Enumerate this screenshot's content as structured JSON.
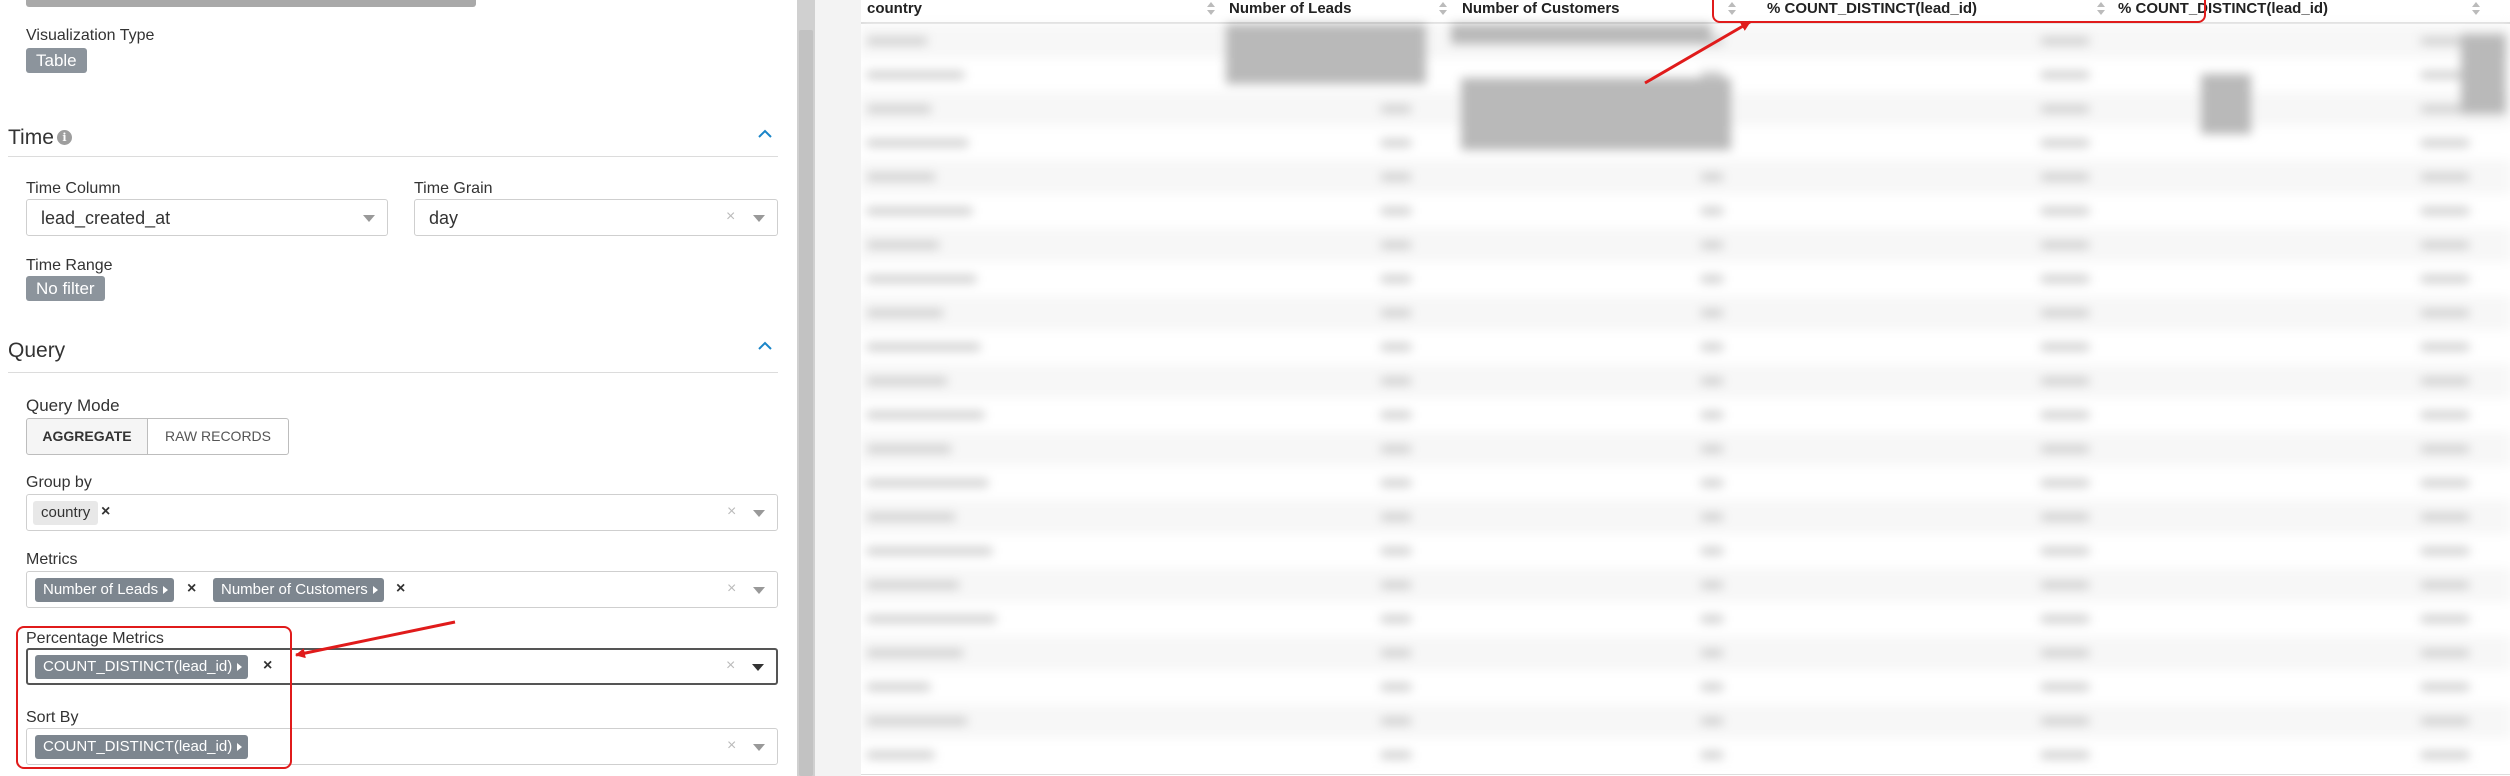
{
  "left_panel": {
    "viz_type_label": "Visualization Type",
    "viz_type_value": "Table",
    "time_section": {
      "title": "Time",
      "info_icon": "i",
      "time_column_label": "Time Column",
      "time_column_value": "lead_created_at",
      "time_grain_label": "Time Grain",
      "time_grain_value": "day",
      "time_range_label": "Time Range",
      "time_range_value": "No filter"
    },
    "query_section": {
      "title": "Query",
      "query_mode_label": "Query Mode",
      "modes": [
        "AGGREGATE",
        "RAW RECORDS"
      ],
      "group_by_label": "Group by",
      "group_by_chips": [
        "country"
      ],
      "metrics_label": "Metrics",
      "metrics_chips": [
        "Number of Leads",
        "Number of Customers"
      ],
      "percentage_metrics_label": "Percentage Metrics",
      "percentage_metrics_chips": [
        "COUNT_DISTINCT(lead_id)"
      ],
      "sort_by_label": "Sort By",
      "sort_by_chips": [
        "COUNT_DISTINCT(lead_id)"
      ]
    },
    "icons": {
      "remove": "×",
      "clear": "×"
    }
  },
  "table": {
    "columns": [
      "country",
      "Number of Leads",
      "Number of Customers",
      "% COUNT_DISTINCT(lead_id)",
      "% COUNT_DISTINCT(lead_id)"
    ]
  },
  "colors": {
    "annotation_red": "#e01b1b",
    "pill_grey": "#8c949c",
    "accent_blue": "#1a85c8"
  }
}
